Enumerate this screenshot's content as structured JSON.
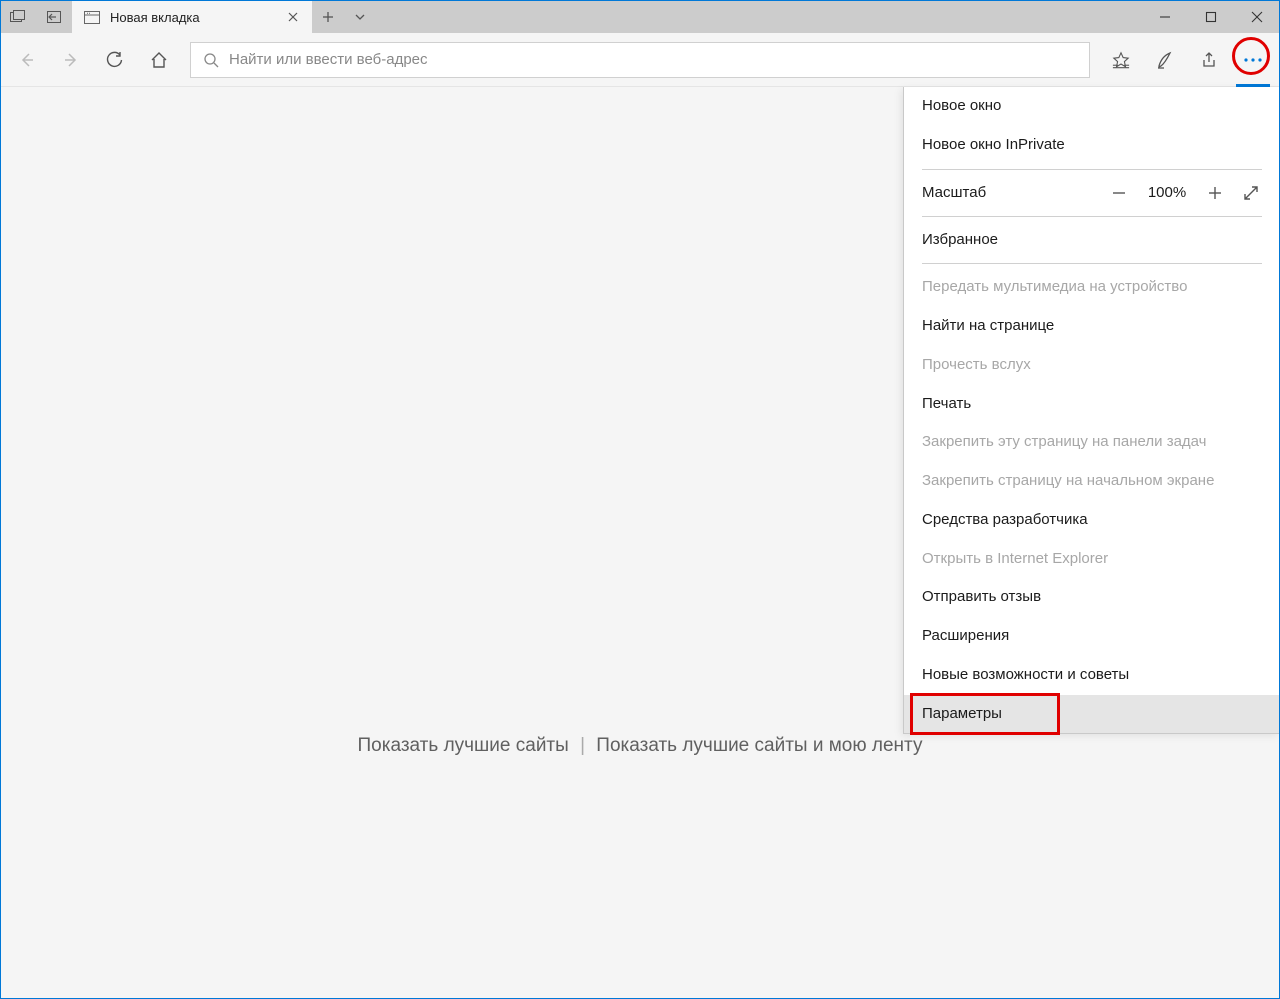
{
  "tab": {
    "title": "Новая вкладка"
  },
  "toolbar": {
    "placeholder": "Найти или ввести веб-адрес"
  },
  "content": {
    "link1": "Показать лучшие сайты",
    "sep": "|",
    "link2": "Показать лучшие сайты и мою ленту"
  },
  "menu": {
    "new_window": "Новое окно",
    "new_inprivate": "Новое окно InPrivate",
    "zoom_label": "Масштаб",
    "zoom_value": "100%",
    "favorites": "Избранное",
    "cast": "Передать мультимедиа на устройство",
    "find": "Найти на странице",
    "read_aloud": "Прочесть вслух",
    "print": "Печать",
    "pin_taskbar": "Закрепить эту страницу на панели задач",
    "pin_start": "Закрепить страницу на начальном экране",
    "devtools": "Средства разработчика",
    "open_ie": "Открыть в Internet Explorer",
    "feedback": "Отправить отзыв",
    "extensions": "Расширения",
    "whatsnew": "Новые возможности и советы",
    "settings": "Параметры"
  }
}
